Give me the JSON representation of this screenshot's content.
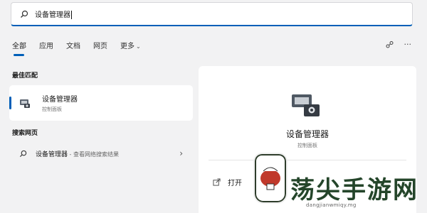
{
  "search": {
    "query": "设备管理器"
  },
  "tabs": [
    {
      "label": "全部",
      "active": true
    },
    {
      "label": "应用"
    },
    {
      "label": "文档"
    },
    {
      "label": "网页"
    },
    {
      "label": "更多"
    }
  ],
  "toolbar": {
    "icons": [
      "share-icon",
      "more-icon"
    ],
    "more_glyph": "···"
  },
  "best_match": {
    "section_label": "最佳匹配",
    "title": "设备管理器",
    "subtitle": "控制面板"
  },
  "web_search": {
    "section_label": "搜索网页",
    "title": "设备管理器",
    "suffix": " - 查看网络搜索结果"
  },
  "detail": {
    "title": "设备管理器",
    "subtitle": "控制面板",
    "action_open": "打开"
  },
  "watermark": {
    "text": "荡尖手游网",
    "url": "dangjianwmiqy.mg"
  },
  "colors": {
    "accent": "#005fb8",
    "background": "#f2f2f3",
    "panel": "#ffffff",
    "watermark_green": "#24452a"
  }
}
